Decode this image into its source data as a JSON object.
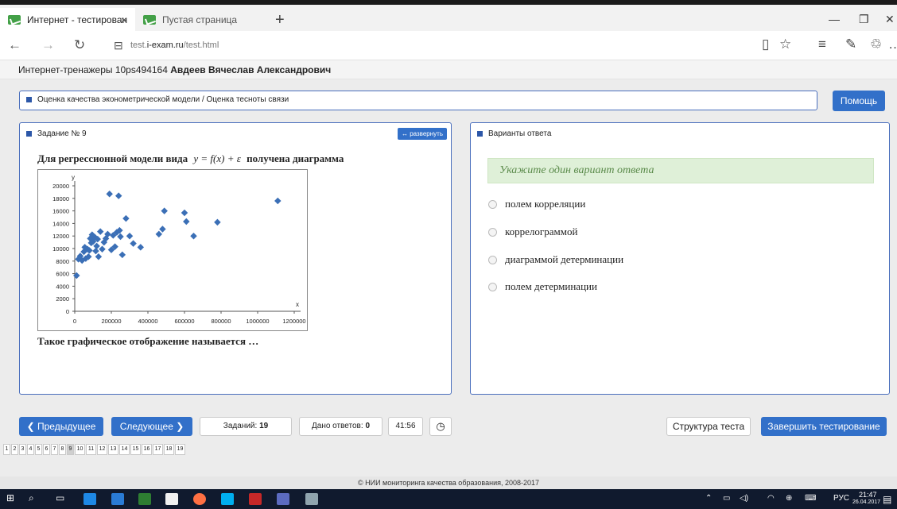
{
  "browser": {
    "tabs": [
      {
        "label": "Интернет - тестирован",
        "close": "×"
      },
      {
        "label": "Пустая страница"
      }
    ],
    "new_tab": "+",
    "url_prefix": "test.",
    "url_domain": "i-exam.ru",
    "url_path": "/test.html"
  },
  "header": {
    "prefix": "Интернет-тренажеры 10ps494164",
    "user": "Авдеев Вячеслав Александрович"
  },
  "topic": {
    "text": "Оценка качества эконометрической модели / Оценка тесноты связи",
    "help_label": "Помощь"
  },
  "task": {
    "title": "Задание № 9",
    "expand_label": "↔ развернуть",
    "question_before": "Для регрессионной модели вида",
    "formula": "y = f(x) + ε",
    "question_after": "получена диаграмма",
    "question2": "Такое графическое отображение называется …"
  },
  "answers": {
    "title": "Варианты ответа",
    "hint": "Укажите один вариант ответа",
    "options": [
      "полем корреляции",
      "коррелограммой",
      "диаграммой детерминации",
      "полем детерминации"
    ]
  },
  "controls": {
    "prev_label": "❮ Предыдущее",
    "next_label": "Следующее ❯",
    "tasks_label": "Заданий:",
    "tasks_count": "19",
    "answered_label": "Дано ответов:",
    "answered_count": "0",
    "timer": "41:56",
    "structure_label": "Структура теста",
    "finish_label": "Завершить тестирование"
  },
  "pages": [
    "1",
    "2",
    "3",
    "4",
    "5",
    "6",
    "7",
    "8",
    "9",
    "10",
    "11",
    "12",
    "13",
    "14",
    "15",
    "16",
    "17",
    "18",
    "19"
  ],
  "current_page": "9",
  "footer": "© НИИ мониторинга качества образования, 2008-2017",
  "taskbar": {
    "lang": "РУС",
    "time": "21:47",
    "date": "26.04.2017"
  },
  "colors": {
    "accent": "#3270c9",
    "points": "#3b6fb6",
    "hint_bg": "#dff0d8"
  },
  "chart_data": {
    "type": "scatter",
    "xlabel": "x",
    "ylabel": "y",
    "xlim": [
      0,
      1200000
    ],
    "ylim": [
      0,
      20000
    ],
    "xticks": [
      "0",
      "200000",
      "400000",
      "600000",
      "800000",
      "1000000",
      "1200000"
    ],
    "yticks": [
      "0",
      "2000",
      "4000",
      "6000",
      "8000",
      "10000",
      "12000",
      "14000",
      "16000",
      "18000",
      "20000"
    ],
    "grid": false,
    "points": [
      [
        10000,
        5700
      ],
      [
        20000,
        8300
      ],
      [
        30000,
        8800
      ],
      [
        40000,
        8100
      ],
      [
        50000,
        9500
      ],
      [
        55000,
        10200
      ],
      [
        60000,
        8400
      ],
      [
        70000,
        9900
      ],
      [
        75000,
        8700
      ],
      [
        80000,
        9700
      ],
      [
        85000,
        11600
      ],
      [
        90000,
        10900
      ],
      [
        95000,
        12200
      ],
      [
        100000,
        11100
      ],
      [
        110000,
        11800
      ],
      [
        115000,
        9600
      ],
      [
        120000,
        10400
      ],
      [
        125000,
        11500
      ],
      [
        130000,
        8700
      ],
      [
        140000,
        12700
      ],
      [
        150000,
        9900
      ],
      [
        160000,
        11000
      ],
      [
        170000,
        11600
      ],
      [
        180000,
        12300
      ],
      [
        190000,
        18700
      ],
      [
        200000,
        9800
      ],
      [
        210000,
        12100
      ],
      [
        220000,
        10300
      ],
      [
        230000,
        12600
      ],
      [
        240000,
        18400
      ],
      [
        245000,
        12900
      ],
      [
        250000,
        11900
      ],
      [
        260000,
        9000
      ],
      [
        280000,
        14800
      ],
      [
        300000,
        12000
      ],
      [
        320000,
        10800
      ],
      [
        360000,
        10200
      ],
      [
        460000,
        12300
      ],
      [
        480000,
        13100
      ],
      [
        490000,
        16000
      ],
      [
        600000,
        15700
      ],
      [
        610000,
        14300
      ],
      [
        650000,
        12000
      ],
      [
        780000,
        14200
      ],
      [
        1110000,
        17600
      ]
    ]
  }
}
